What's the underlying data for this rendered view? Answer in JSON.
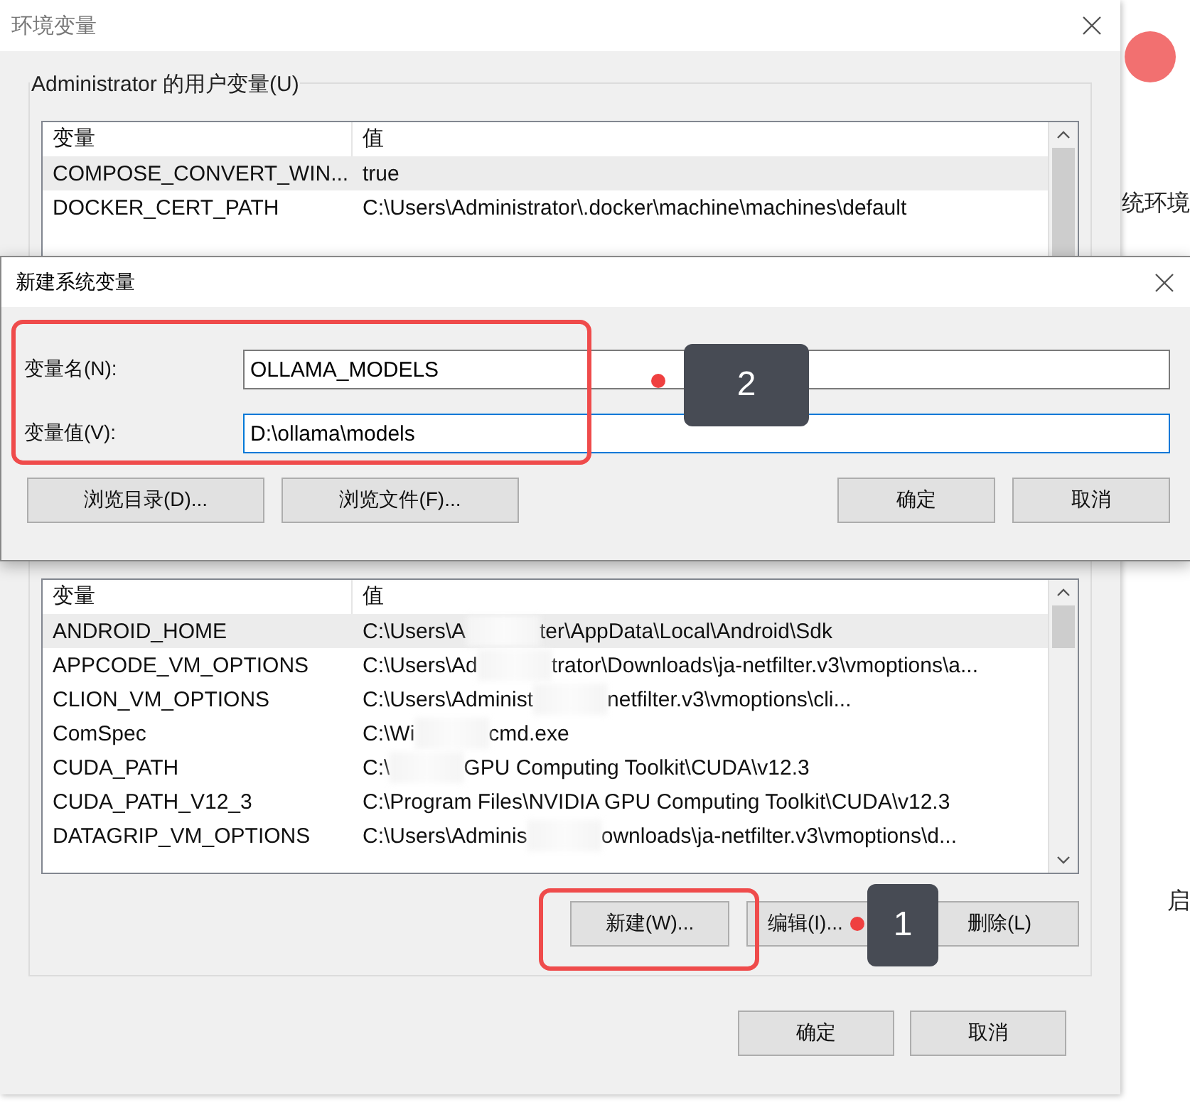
{
  "main_window": {
    "title": "环境变量",
    "user_group": {
      "label": "Administrator 的用户变量(U)",
      "columns": [
        "变量",
        "值"
      ],
      "rows": [
        {
          "name": "COMPOSE_CONVERT_WIN...",
          "value": [
            "true"
          ],
          "selected": true
        },
        {
          "name": "DOCKER_CERT_PATH",
          "value": [
            "C:\\Users\\Administrator\\.docker\\machine\\machines\\default"
          ],
          "selected": false
        }
      ]
    },
    "system_group": {
      "columns": [
        "变量",
        "值"
      ],
      "rows": [
        {
          "name": "ANDROID_HOME",
          "value": [
            "C:\\Users\\A",
            "ter\\AppData\\Local\\Android\\Sdk"
          ],
          "selected": true
        },
        {
          "name": "APPCODE_VM_OPTIONS",
          "value": [
            "C:\\Users\\Ad",
            "trator\\Downloads\\ja-netfilter.v3\\vmoptions\\a..."
          ],
          "selected": false
        },
        {
          "name": "CLION_VM_OPTIONS",
          "value": [
            "C:\\Users\\Administ",
            "netfilter.v3\\vmoptions\\cli..."
          ],
          "selected": false
        },
        {
          "name": "ComSpec",
          "value": [
            "C:\\Wi",
            "cmd.exe"
          ],
          "selected": false
        },
        {
          "name": "CUDA_PATH",
          "value": [
            "C:\\",
            "GPU Computing Toolkit\\CUDA\\v12.3"
          ],
          "selected": false
        },
        {
          "name": "CUDA_PATH_V12_3",
          "value": [
            "C:\\Program Files\\NVIDIA GPU Computing Toolkit\\CUDA\\v12.3"
          ],
          "selected": false
        },
        {
          "name": "DATAGRIP_VM_OPTIONS",
          "value": [
            "C:\\Users\\Adminis",
            "ownloads\\ja-netfilter.v3\\vmoptions\\d..."
          ],
          "selected": false
        }
      ],
      "buttons": [
        "新建(W)...",
        "编辑(I)...",
        "删除(L)"
      ]
    },
    "buttons": [
      "确定",
      "取消"
    ]
  },
  "dialog": {
    "title": "新建系统变量",
    "fields": [
      {
        "label": "变量名(N):",
        "value": "OLLAMA_MODELS",
        "focused": false
      },
      {
        "label": "变量值(V):",
        "value": "D:\\ollama\\models",
        "focused": true
      }
    ],
    "left_buttons": [
      "浏览目录(D)...",
      "浏览文件(F)..."
    ],
    "right_buttons": [
      "确定",
      "取消"
    ]
  },
  "annotations": [
    {
      "number": "2"
    },
    {
      "number": "1"
    }
  ],
  "background_page": {
    "heading": "统环境",
    "button": "启"
  }
}
